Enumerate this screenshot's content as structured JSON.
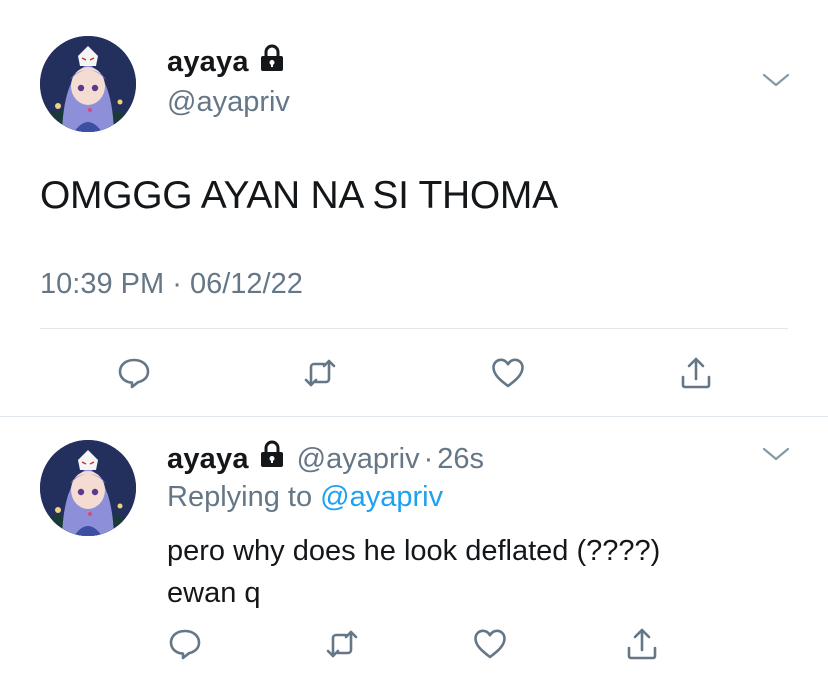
{
  "tweet": {
    "author_name": "ayaya",
    "author_handle": "@ayapriv",
    "text": "OMGGG AYAN NA SI THOMA",
    "time": "10:39 PM",
    "date": "06/12/22",
    "dot": "·"
  },
  "reply": {
    "author_name": "ayaya",
    "author_handle": "@ayapriv",
    "dot": "·",
    "age": "26s",
    "replying_prefix": "Replying to",
    "replying_to": "@ayapriv",
    "text_line1": "pero why does he look deflated (????)",
    "text_line2": "ewan q"
  },
  "icons": {
    "reply": "reply-icon",
    "retweet": "retweet-icon",
    "like": "heart-icon",
    "share": "share-icon",
    "lock": "lock-icon",
    "more": "chevron-down-icon"
  },
  "colors": {
    "text": "#14171a",
    "secondary": "#657786",
    "link": "#1da1f2",
    "divider": "#e1e8ed"
  }
}
